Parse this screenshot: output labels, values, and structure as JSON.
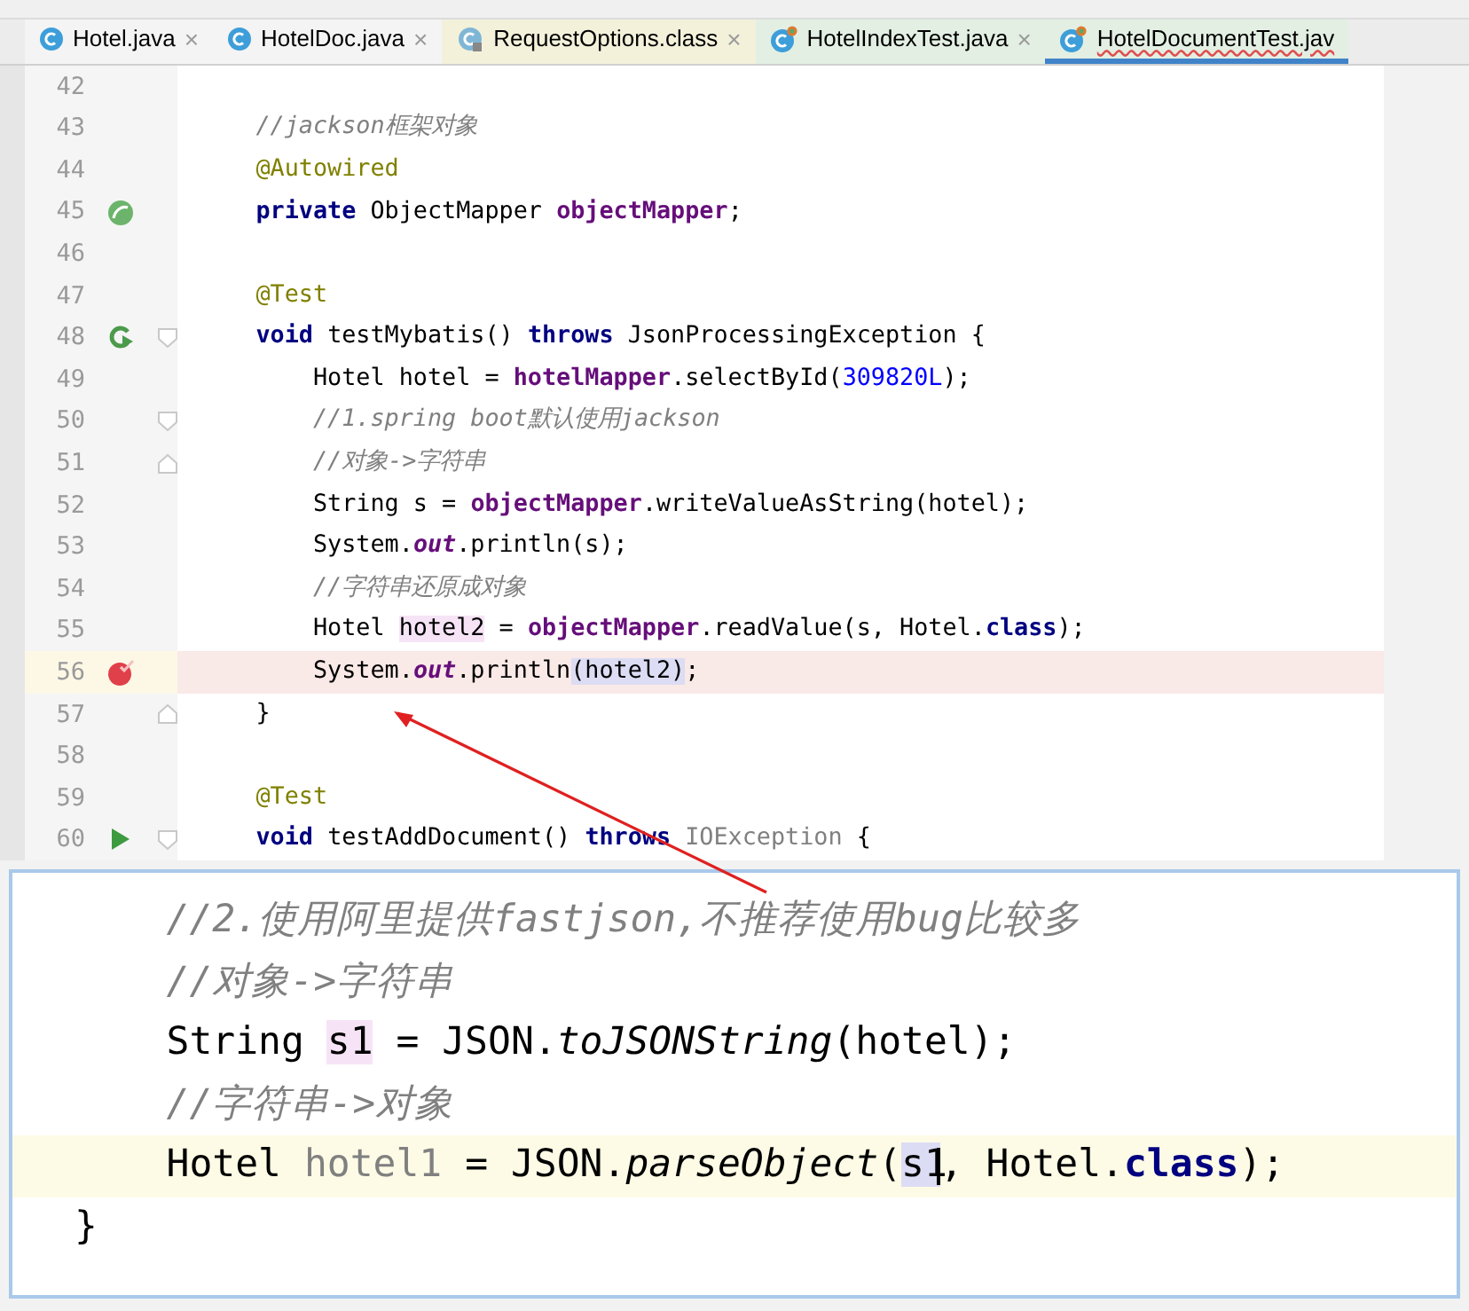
{
  "tabs": [
    {
      "label": "Hotel.java",
      "kind": "class",
      "close": "×",
      "selected": false
    },
    {
      "label": "HotelDoc.java",
      "kind": "class",
      "close": "×",
      "selected": false
    },
    {
      "label": "RequestOptions.class",
      "kind": "compiled",
      "close": "×",
      "selected": false
    },
    {
      "label": "HotelIndexTest.java",
      "kind": "test",
      "close": "×",
      "selected": false
    },
    {
      "label": "HotelDocumentTest.jav",
      "kind": "test",
      "selected": true
    }
  ],
  "editor": {
    "lines": [
      {
        "number": "42"
      },
      {
        "number": "43",
        "tokens": [
          {
            "kind": "comment",
            "text": "    //jackson框架对象"
          }
        ]
      },
      {
        "number": "44",
        "tokens": [
          {
            "kind": "annotation",
            "text": "    @Autowired"
          }
        ]
      },
      {
        "number": "45",
        "gutter": {
          "kind": "bean"
        },
        "tokens": [
          {
            "kind": "keyword",
            "text": "    private "
          },
          {
            "kind": "plain",
            "text": "ObjectMapper "
          },
          {
            "kind": "field",
            "text": "objectMapper"
          },
          {
            "kind": "plain",
            "text": ";"
          }
        ]
      },
      {
        "number": "46"
      },
      {
        "number": "47",
        "tokens": [
          {
            "kind": "annotation",
            "text": "    @Test"
          }
        ]
      },
      {
        "number": "48",
        "gutter": {
          "kind": "rerun"
        },
        "fold": {
          "kind": "open"
        },
        "tokens": [
          {
            "kind": "keyword",
            "text": "    void "
          },
          {
            "kind": "plain",
            "text": "testMybatis() "
          },
          {
            "kind": "keyword",
            "text": "throws "
          },
          {
            "kind": "plain",
            "text": "JsonProcessingException {"
          }
        ]
      },
      {
        "number": "49",
        "tokens": [
          {
            "kind": "plain",
            "text": "        Hotel hotel = "
          },
          {
            "kind": "field",
            "text": "hotelMapper"
          },
          {
            "kind": "plain",
            "text": ".selectById("
          },
          {
            "kind": "number",
            "text": "309820L"
          },
          {
            "kind": "plain",
            "text": ");"
          }
        ]
      },
      {
        "number": "50",
        "fold": {
          "kind": "open"
        },
        "tokens": [
          {
            "kind": "comment",
            "text": "        //1.spring boot默认使用jackson"
          }
        ]
      },
      {
        "number": "51",
        "fold": {
          "kind": "close"
        },
        "tokens": [
          {
            "kind": "comment",
            "text": "        //对象->字符串"
          }
        ]
      },
      {
        "number": "52",
        "tokens": [
          {
            "kind": "plain",
            "text": "        String s = "
          },
          {
            "kind": "field",
            "text": "objectMapper"
          },
          {
            "kind": "plain",
            "text": ".writeValueAsString(hotel);"
          }
        ]
      },
      {
        "number": "53",
        "tokens": [
          {
            "kind": "plain",
            "text": "        System."
          },
          {
            "kind": "static",
            "text": "out"
          },
          {
            "kind": "plain",
            "text": ".println(s);"
          }
        ]
      },
      {
        "number": "54",
        "tokens": [
          {
            "kind": "comment",
            "text": "        //字符串还原成对象"
          }
        ]
      },
      {
        "number": "55",
        "tokens": [
          {
            "kind": "plain",
            "text": "        Hotel "
          },
          {
            "kind": "plain",
            "text": "hotel2",
            "write_highlight": true
          },
          {
            "kind": "plain",
            "text": " = "
          },
          {
            "kind": "field",
            "text": "objectMapper"
          },
          {
            "kind": "plain",
            "text": ".readValue(s, Hotel."
          },
          {
            "kind": "keyword",
            "text": "class"
          },
          {
            "kind": "plain",
            "text": ");"
          }
        ]
      },
      {
        "number": "56",
        "gutter": {
          "kind": "breakpoint"
        },
        "highlighted": true,
        "tokens": [
          {
            "kind": "plain",
            "text": "        System."
          },
          {
            "kind": "static",
            "text": "out"
          },
          {
            "kind": "plain",
            "text": ".println"
          },
          {
            "kind": "plain",
            "text": "(hotel2)",
            "read_highlight": true
          },
          {
            "kind": "plain",
            "text": ";"
          }
        ]
      },
      {
        "number": "57",
        "fold": {
          "kind": "close"
        },
        "tokens": [
          {
            "kind": "plain",
            "text": "    }"
          }
        ]
      },
      {
        "number": "58"
      },
      {
        "number": "59",
        "tokens": [
          {
            "kind": "annotation",
            "text": "    @Test"
          }
        ]
      },
      {
        "number": "60",
        "gutter": {
          "kind": "run"
        },
        "fold": {
          "kind": "open"
        },
        "tokens": [
          {
            "kind": "keyword",
            "text": "    void "
          },
          {
            "kind": "plain",
            "text": "testAddDocument() "
          },
          {
            "kind": "keyword",
            "text": "throws "
          },
          {
            "kind": "unused",
            "text": "IOException"
          },
          {
            "kind": "plain",
            "text": " {"
          }
        ]
      }
    ]
  },
  "popup": {
    "lines": [
      {
        "tokens": [
          {
            "kind": "comment",
            "text": "    //2.使用阿里提供fastjson,不推荐使用bug比较多"
          }
        ]
      },
      {
        "tokens": [
          {
            "kind": "comment",
            "text": "    //对象->字符串"
          }
        ]
      },
      {
        "tokens": [
          {
            "kind": "plain",
            "text": "    String "
          },
          {
            "kind": "plain",
            "text": "s1",
            "write_highlight": true
          },
          {
            "kind": "plain",
            "text": " = JSON."
          },
          {
            "kind": "italic",
            "text": "toJSONString"
          },
          {
            "kind": "plain",
            "text": "(hotel);"
          }
        ]
      },
      {
        "tokens": [
          {
            "kind": "comment",
            "text": "    //字符串->对象"
          }
        ]
      },
      {
        "highlighted": true,
        "tokens": [
          {
            "kind": "plain",
            "text": "    Hotel "
          },
          {
            "kind": "unused",
            "text": "hotel1"
          },
          {
            "kind": "plain",
            "text": " = JSON."
          },
          {
            "kind": "italic",
            "text": "parseObject"
          },
          {
            "kind": "plain",
            "text": "("
          },
          {
            "kind": "plain",
            "text": "s1",
            "read_highlight": true,
            "caret": true
          },
          {
            "kind": "plain",
            "text": ", Hotel."
          },
          {
            "kind": "keyword",
            "text": "class"
          },
          {
            "kind": "plain",
            "text": ");"
          }
        ]
      },
      {
        "tokens": [
          {
            "kind": "plain",
            "text": "}"
          }
        ]
      }
    ]
  }
}
